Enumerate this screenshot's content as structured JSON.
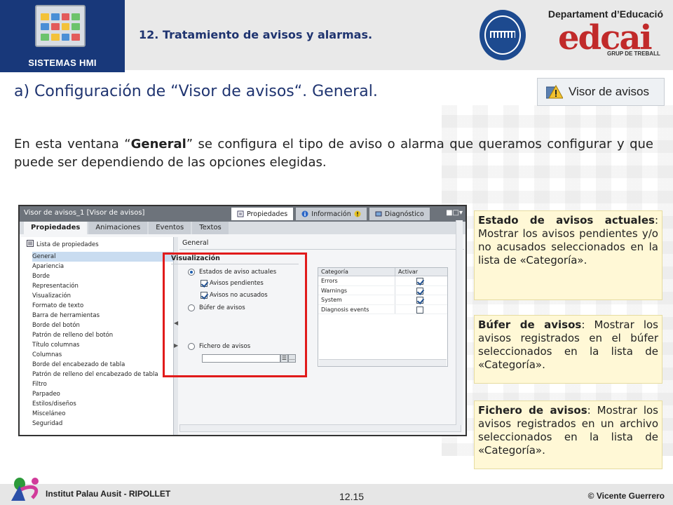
{
  "header": {
    "logo_label": "SISTEMAS HMI",
    "section_title": "12. Tratamiento de avisos y alarmas.",
    "department": "Departament d’Educació",
    "edcai_logo_text": "edcai",
    "grup_logo_text": "GRUP DE TREBALL",
    "colors": {
      "header_blue": "#18387a",
      "title_blue": "#1f3470",
      "edcai_red": "#c12a2a"
    }
  },
  "heading": "a) Configuración de “Visor de avisos“. General.",
  "visor_badge": {
    "label": "Visor de avisos",
    "icon": "warning-icon"
  },
  "paragraph": {
    "before": "En esta ventana “",
    "bold": "General",
    "after": "” se configura el tipo de aviso o alarma que queramos configurar y que puede ser dependiendo de las opciones elegidas."
  },
  "screenshot": {
    "window_title": "Visor de avisos_1 [Visor de avisos]",
    "right_tabs": [
      {
        "label": "Propiedades",
        "icon": "properties-icon",
        "active": true
      },
      {
        "label": "Información",
        "icon": "info-icon",
        "active": false
      },
      {
        "label": "Diagnóstico",
        "icon": "diagnostics-icon",
        "active": false
      }
    ],
    "tabs": [
      "Propiedades",
      "Animaciones",
      "Eventos",
      "Textos"
    ],
    "prop_list_header": "Lista de propiedades",
    "prop_items": [
      "General",
      "Apariencia",
      "Borde",
      "Representación",
      "Visualización",
      "Formato de texto",
      "Barra de herramientas",
      "Borde del botón",
      "Patrón de relleno del botón",
      "Título columnas",
      "Columnas",
      "Borde del encabezado de tabla",
      "Patrón de relleno del encabezado de tabla",
      "Filtro",
      "Parpadeo",
      "Estilos/diseños",
      "Misceláneo",
      "Seguridad"
    ],
    "selected_item": "General",
    "general_label": "General",
    "visualizacion": {
      "title": "Visualización",
      "radio_current": "Estados de aviso actuales",
      "cb_pending": "Avisos pendientes",
      "cb_unack": "Avisos no acusados",
      "radio_buffer": "Búfer de avisos",
      "radio_file": "Fichero de avisos"
    },
    "category_table": {
      "headers": [
        "Categoría",
        "Activar"
      ],
      "rows": [
        {
          "name": "Errors",
          "active": true
        },
        {
          "name": "Warnings",
          "active": true
        },
        {
          "name": "System",
          "active": true
        },
        {
          "name": "Diagnosis events",
          "active": false
        }
      ]
    }
  },
  "callouts": {
    "estado": {
      "title": "Estado de avisos actuales",
      "text": ": Mostrar los avisos pendientes y/o no acusados seleccionados en la lista de «Categoría»."
    },
    "bufer": {
      "title": "Búfer de avisos",
      "text": ": Mostrar los avisos registrados en el búfer seleccionados en la lista de «Categoría»."
    },
    "fichero": {
      "title": "Fichero de avisos",
      "text": ": Mostrar los avisos registrados en un archivo seleccionados en la lista de «Categoría»."
    }
  },
  "footer": {
    "institute": "Institut Palau Ausit - RIPOLLET",
    "page": "12.15",
    "author": "© Vicente Guerrero"
  }
}
